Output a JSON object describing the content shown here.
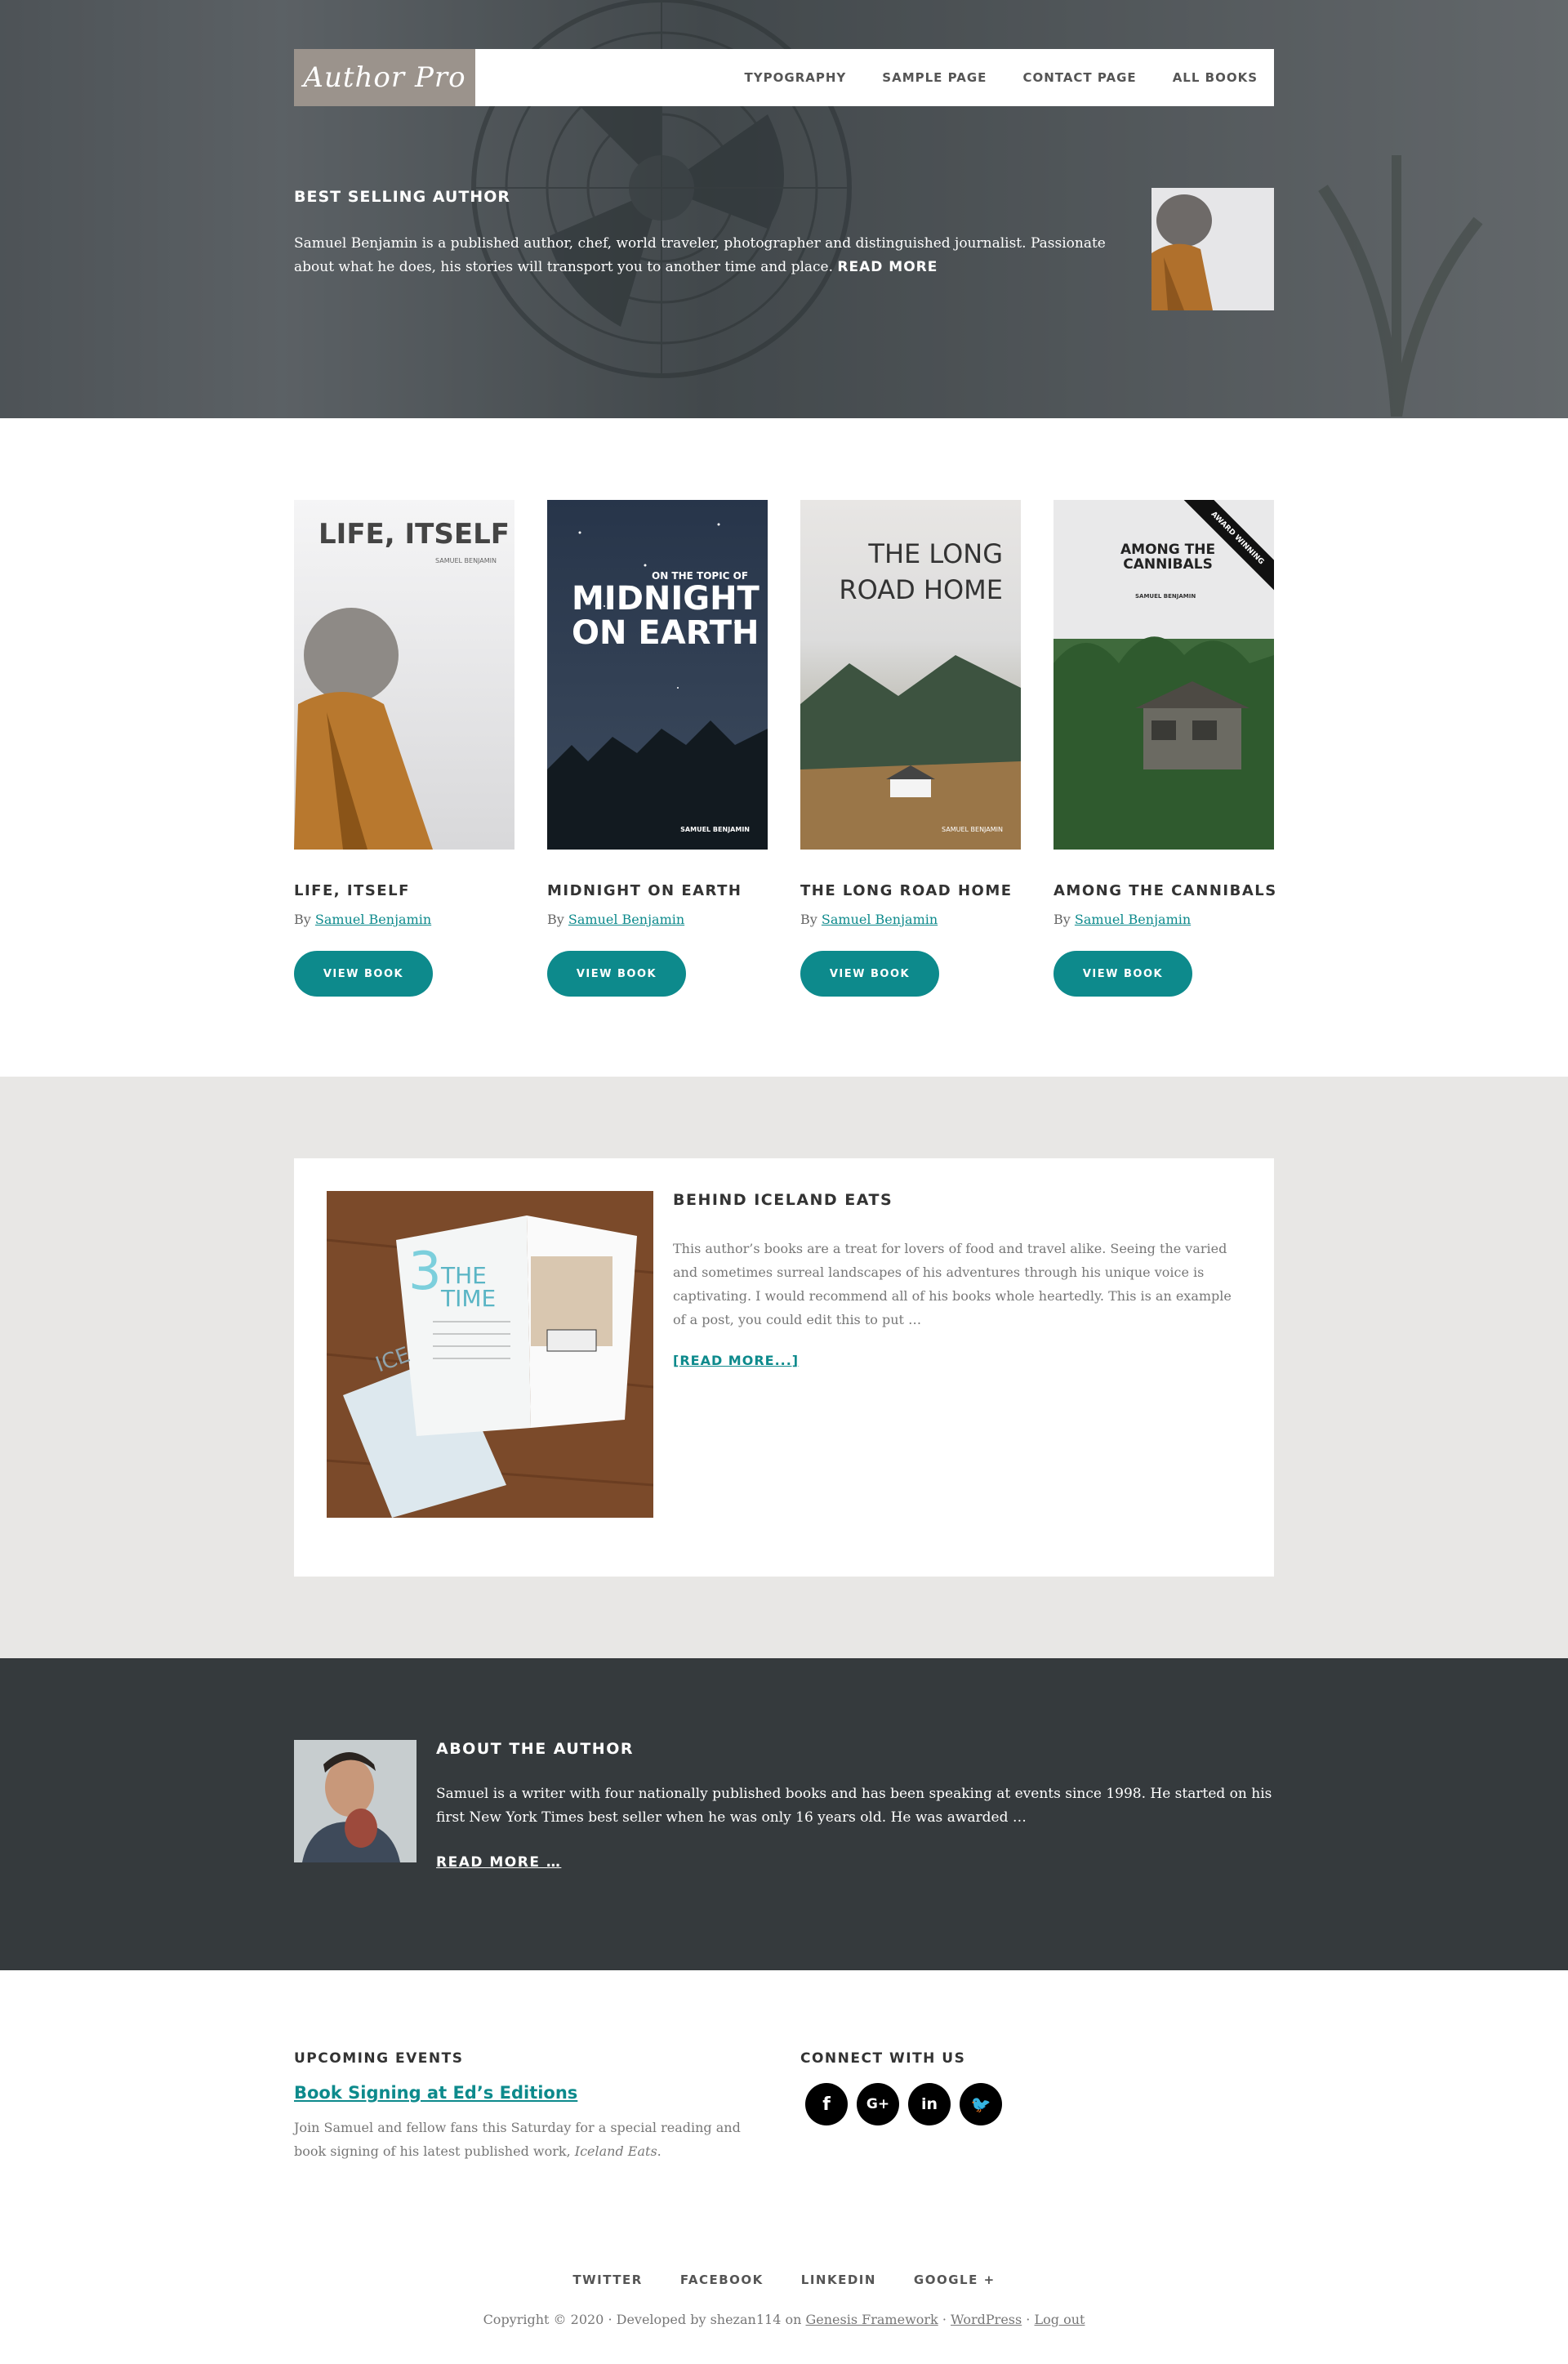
{
  "nav": {
    "logo": "Author Pro",
    "items": [
      "TYPOGRAPHY",
      "SAMPLE PAGE",
      "CONTACT PAGE",
      "ALL BOOKS"
    ]
  },
  "hero": {
    "heading": "BEST SELLING AUTHOR",
    "bio": "Samuel Benjamin is a published author, chef, world traveler, photographer and distinguished journalist. Passionate about what he does, his stories will transport you to another time and place.",
    "read_more": "READ MORE"
  },
  "books": [
    {
      "title": "LIFE, ITSELF",
      "by": "By",
      "author": "Samuel Benjamin",
      "button": "VIEW BOOK",
      "cover_title": "LIFE, ITSELF",
      "cover_author": "SAMUEL BENJAMIN"
    },
    {
      "title": "MIDNIGHT ON EARTH",
      "by": "By",
      "author": "Samuel Benjamin",
      "button": "VIEW BOOK",
      "cover_kicker": "ON THE TOPIC OF",
      "cover_title_1": "MIDNIGHT",
      "cover_title_2": "ON EARTH",
      "cover_author": "SAMUEL BENJAMIN"
    },
    {
      "title": "THE LONG ROAD HOME",
      "by": "By",
      "author": "Samuel Benjamin",
      "button": "VIEW BOOK",
      "cover_title_1": "THE LONG",
      "cover_title_2": "ROAD HOME",
      "cover_author": "SAMUEL BENJAMIN"
    },
    {
      "title": "AMONG THE CANNIBALS",
      "by": "By",
      "author": "Samuel Benjamin",
      "button": "VIEW BOOK",
      "cover_title_1": "AMONG THE",
      "cover_title_2": "CANNIBALS",
      "cover_author": "SAMUEL BENJAMIN",
      "ribbon": "AWARD WINNING"
    }
  ],
  "featured": {
    "title": "BEHIND ICELAND EATS",
    "excerpt": "This author’s books are a treat for lovers of food and travel alike. Seeing the varied and sometimes surreal landscapes of his adventures through his unique voice is captivating. I would recommend all of his books whole heartedly. This is an example of a post, you could edit this to put …",
    "read_more": "[READ MORE...]",
    "image_text_1": "THE",
    "image_text_2": "TIME",
    "image_text_3": "ICE",
    "image_number": "3"
  },
  "about": {
    "heading": "ABOUT THE AUTHOR",
    "text": "Samuel is a writer with four nationally published books and has been speaking at events since 1998. He started on his first New York Times best seller when he was only 16 years old. He was awarded …",
    "read_more": "READ MORE …"
  },
  "events": {
    "heading": "UPCOMING EVENTS",
    "link": "Book Signing at Ed’s Editions",
    "desc_before": "Join Samuel and fellow fans this Saturday for a special reading and book signing of his latest published work,",
    "desc_italic": "Iceland Eats",
    "desc_after": "."
  },
  "connect": {
    "heading": "CONNECT WITH US",
    "icons": [
      "f",
      "G+",
      "in",
      "🐦"
    ]
  },
  "footer": {
    "nav": [
      "TWITTER",
      "FACEBOOK",
      "LINKEDIN",
      "GOOGLE +"
    ],
    "copy_prefix": "Copyright © 2020 · Developed by shezan114 on",
    "link_genesis": "Genesis Framework",
    "sep1": "·",
    "link_wp": "WordPress",
    "sep2": "·",
    "link_logout": "Log out"
  },
  "colors": {
    "accent": "#0d8a8c",
    "hero_bg": "#5a6064",
    "about_bg": "#353a3d",
    "featured_band": "#e8e7e5",
    "logo_bg": "#9b938c"
  }
}
